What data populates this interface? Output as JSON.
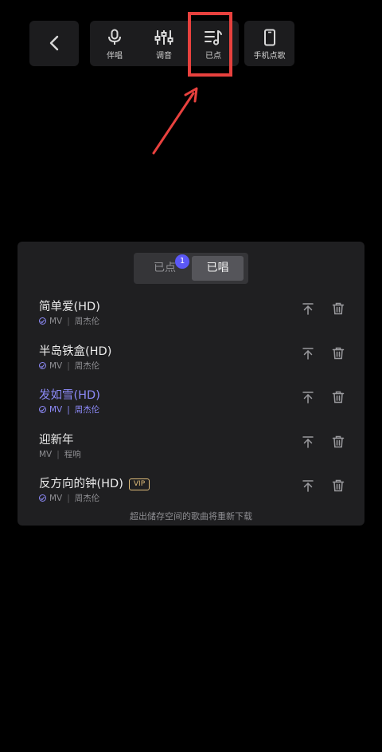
{
  "toolbar": {
    "items": [
      {
        "label": "伴唱",
        "icon": "microphone-icon"
      },
      {
        "label": "调音",
        "icon": "sliders-icon"
      },
      {
        "label": "已点",
        "icon": "playlist-music-icon"
      },
      {
        "label": "手机点歌",
        "icon": "phone-icon"
      }
    ],
    "back_icon": "chevron-left-icon"
  },
  "annotation": {
    "highlight_color": "#e8413e"
  },
  "panel": {
    "tabs": [
      {
        "label": "已点",
        "badge": "1"
      },
      {
        "label": "已唱",
        "selected": true
      }
    ],
    "songs": [
      {
        "title": "简单爱(HD)",
        "type": "MV",
        "artist": "周杰伦",
        "downloaded": true,
        "vip": "",
        "active": false
      },
      {
        "title": "半岛铁盒(HD)",
        "type": "MV",
        "artist": "周杰伦",
        "downloaded": true,
        "vip": "",
        "active": false
      },
      {
        "title": "发如雪(HD)",
        "type": "MV",
        "artist": "周杰伦",
        "downloaded": true,
        "vip": "",
        "active": true
      },
      {
        "title": "迎新年",
        "type": "MV",
        "artist": "程响",
        "downloaded": false,
        "vip": "",
        "active": false
      },
      {
        "title": "反方向的钟(HD)",
        "type": "MV",
        "artist": "周杰伦",
        "downloaded": true,
        "vip": "VIP",
        "active": false
      }
    ],
    "footer_note": "超出储存空间的歌曲将重新下载",
    "accent_color": "#8d8af8"
  }
}
